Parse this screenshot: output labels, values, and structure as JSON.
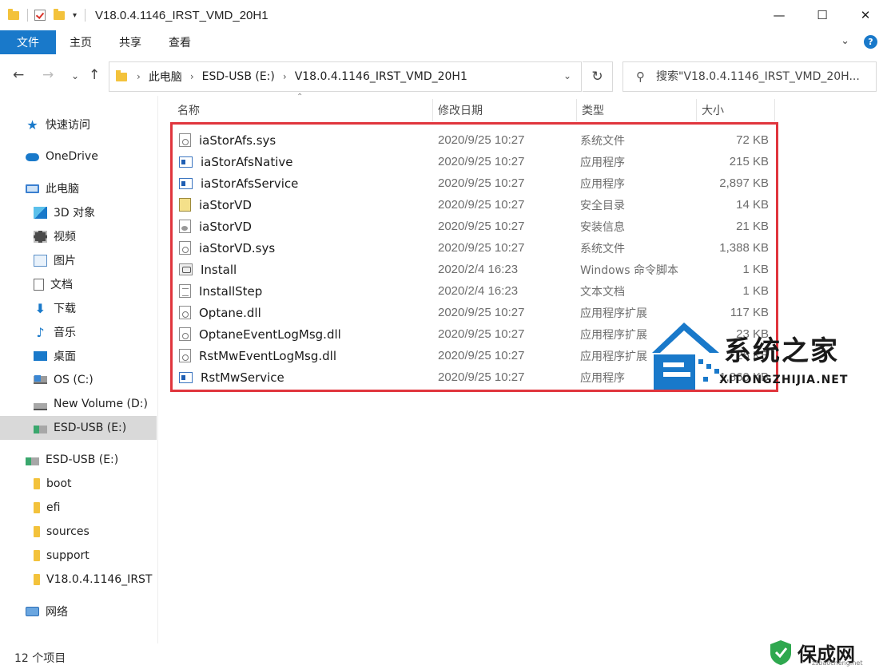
{
  "window": {
    "title": "V18.0.4.1146_IRST_VMD_20H1",
    "minimize_glyph": "—",
    "maximize_glyph": "☐",
    "close_glyph": "✕"
  },
  "ribbon": {
    "tabs": [
      "文件",
      "主页",
      "共享",
      "查看"
    ],
    "expand_glyph": "⌄",
    "help_glyph": "?"
  },
  "nav": {
    "back_glyph": "←",
    "forward_glyph": "→",
    "recent_glyph": "⌄",
    "up_glyph": "↑",
    "refresh_glyph": "↻"
  },
  "address": {
    "crumbs": [
      "此电脑",
      "ESD-USB (E:)",
      "V18.0.4.1146_IRST_VMD_20H1"
    ],
    "separator": "›",
    "dropdown_glyph": "⌄"
  },
  "search": {
    "placeholder": "搜索\"V18.0.4.1146_IRST_VMD_20H..."
  },
  "sidebar": {
    "quick_access": "快速访问",
    "onedrive": "OneDrive",
    "this_pc": "此电脑",
    "pc_items": [
      "3D 对象",
      "视频",
      "图片",
      "文档",
      "下载",
      "音乐",
      "桌面",
      "OS (C:)",
      "New Volume (D:)",
      "ESD-USB (E:)"
    ],
    "usb_root": "ESD-USB (E:)",
    "usb_items": [
      "boot",
      "efi",
      "sources",
      "support",
      "V18.0.4.1146_IRST"
    ],
    "network": "网络"
  },
  "columns": {
    "name": "名称",
    "date": "修改日期",
    "type": "类型",
    "size": "大小"
  },
  "files": [
    {
      "name": "iaStorAfs.sys",
      "date": "2020/9/25 10:27",
      "type": "系统文件",
      "size": "72 KB",
      "icon": "sys"
    },
    {
      "name": "iaStorAfsNative",
      "date": "2020/9/25 10:27",
      "type": "应用程序",
      "size": "215 KB",
      "icon": "exe"
    },
    {
      "name": "iaStorAfsService",
      "date": "2020/9/25 10:27",
      "type": "应用程序",
      "size": "2,897 KB",
      "icon": "exe"
    },
    {
      "name": "iaStorVD",
      "date": "2020/9/25 10:27",
      "type": "安全目录",
      "size": "14 KB",
      "icon": "cat"
    },
    {
      "name": "iaStorVD",
      "date": "2020/9/25 10:27",
      "type": "安装信息",
      "size": "21 KB",
      "icon": "inf"
    },
    {
      "name": "iaStorVD.sys",
      "date": "2020/9/25 10:27",
      "type": "系统文件",
      "size": "1,388 KB",
      "icon": "sys"
    },
    {
      "name": "Install",
      "date": "2020/2/4 16:23",
      "type": "Windows 命令脚本",
      "size": "1 KB",
      "icon": "cmd"
    },
    {
      "name": "InstallStep",
      "date": "2020/2/4 16:23",
      "type": "文本文档",
      "size": "1 KB",
      "icon": "txt"
    },
    {
      "name": "Optane.dll",
      "date": "2020/9/25 10:27",
      "type": "应用程序扩展",
      "size": "117 KB",
      "icon": "sys"
    },
    {
      "name": "OptaneEventLogMsg.dll",
      "date": "2020/9/25 10:27",
      "type": "应用程序扩展",
      "size": "23 KB",
      "icon": "sys"
    },
    {
      "name": "RstMwEventLogMsg.dll",
      "date": "2020/9/25 10:27",
      "type": "应用程序扩展",
      "size": "26 KB",
      "icon": "sys"
    },
    {
      "name": "RstMwService",
      "date": "2020/9/25 10:27",
      "type": "应用程序",
      "size": "1,860 KB",
      "icon": "exe"
    }
  ],
  "status": {
    "count": "12 个项目"
  },
  "watermarks": {
    "site_name": "系统之家",
    "site_url": "XITONGZHIJIA.NET",
    "corner_name": "保成网",
    "corner_url": "zsbaocheng.net"
  },
  "colors": {
    "accent": "#1979ca",
    "highlight_box": "#e0353d",
    "selected_nav": "#d9d9d9"
  }
}
